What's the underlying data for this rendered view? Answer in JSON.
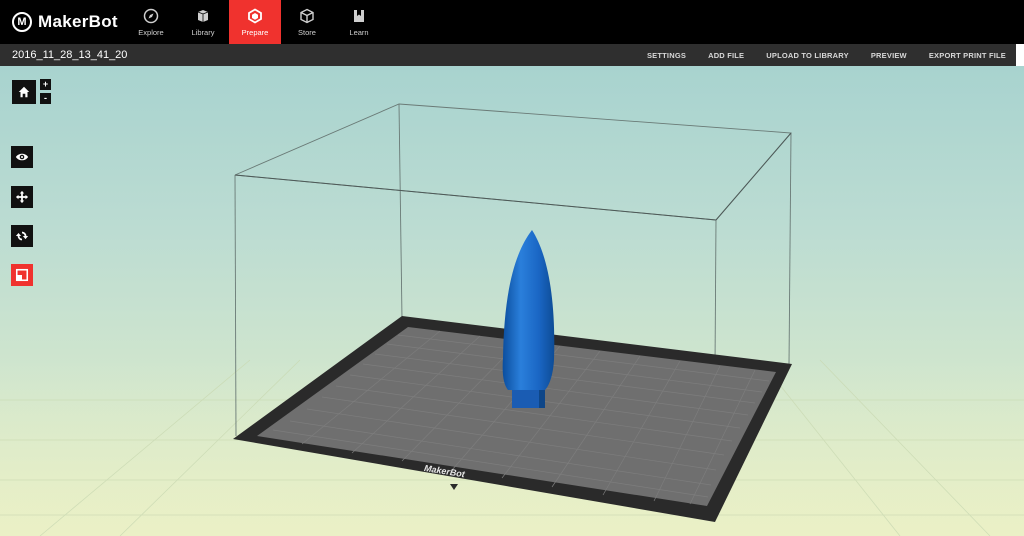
{
  "app": {
    "brand": "MakerBot",
    "logo_mark": "M"
  },
  "nav": {
    "tabs": [
      {
        "label": "Explore",
        "icon": "compass-icon",
        "active": false
      },
      {
        "label": "Library",
        "icon": "library-icon",
        "active": false
      },
      {
        "label": "Prepare",
        "icon": "prepare-icon",
        "active": true
      },
      {
        "label": "Store",
        "icon": "cube-icon",
        "active": false
      },
      {
        "label": "Learn",
        "icon": "book-icon",
        "active": false
      }
    ]
  },
  "toolbar": {
    "file_name": "2016_11_28_13_41_20",
    "settings": "SETTINGS",
    "add_file": "ADD FILE",
    "upload": "UPLOAD TO LIBRARY",
    "preview": "PREVIEW",
    "export": "EXPORT PRINT FILE"
  },
  "view_tools": {
    "zoom_in": "+",
    "zoom_out": "-"
  },
  "build_plate": {
    "brand_label": "MakerBot"
  },
  "colors": {
    "accent": "#f0322e",
    "model": "#1a66c4",
    "plate": "#6f6f6f",
    "plate_border": "#2a2a2a"
  }
}
